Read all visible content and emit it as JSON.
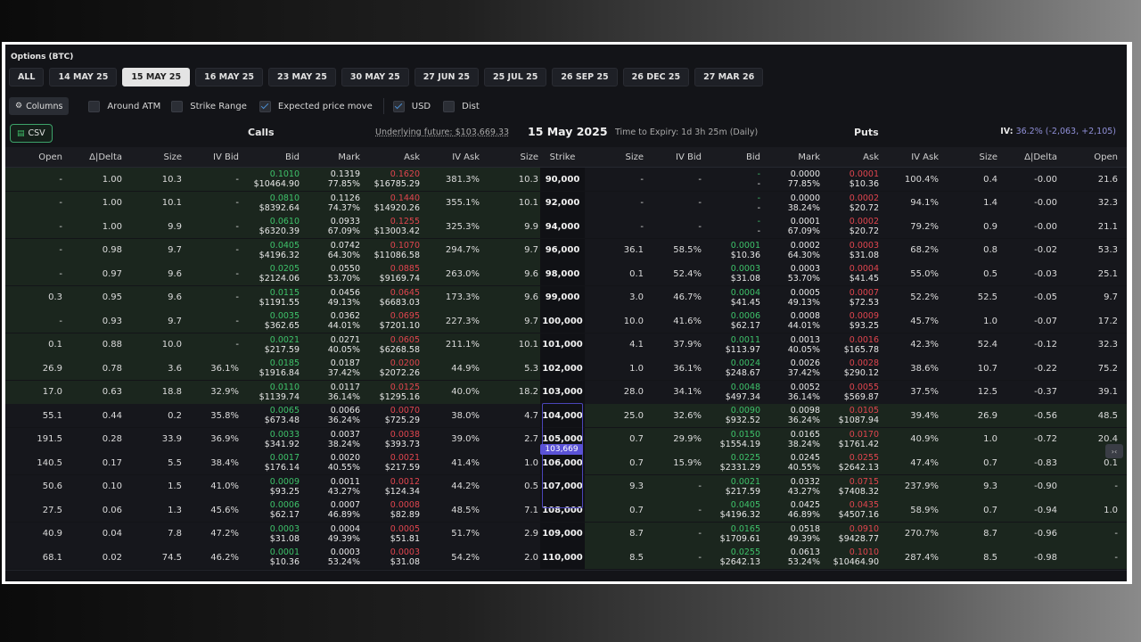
{
  "title": "Options (BTC)",
  "tabs": [
    {
      "label": "ALL",
      "active": false
    },
    {
      "label": "14 MAY 25",
      "active": false
    },
    {
      "label": "15 MAY 25",
      "active": true
    },
    {
      "label": "16 MAY 25",
      "active": false
    },
    {
      "label": "23 MAY 25",
      "active": false
    },
    {
      "label": "30 MAY 25",
      "active": false
    },
    {
      "label": "27 JUN 25",
      "active": false
    },
    {
      "label": "25 JUL 25",
      "active": false
    },
    {
      "label": "26 SEP 25",
      "active": false
    },
    {
      "label": "26 DEC 25",
      "active": false
    },
    {
      "label": "27 MAR 26",
      "active": false
    }
  ],
  "toolbar": {
    "columns_label": "Columns",
    "around_atm": "Around ATM",
    "strike_range": "Strike Range",
    "expected_move": "Expected price move",
    "usd": "USD",
    "dist": "Dist"
  },
  "summary": {
    "csv_label": "CSV",
    "calls": "Calls",
    "underlying": "Underlying future: $103,669.33",
    "date": "15 May 2025",
    "expiry": "Time to Expiry: 1d 3h 25m (Daily)",
    "puts": "Puts",
    "iv_label": "IV:",
    "iv_value": "36.2% (-2,063, +2,105)"
  },
  "columns": [
    "Open",
    "Δ|Delta",
    "Size",
    "IV Bid",
    "Bid",
    "Mark",
    "Ask",
    "IV Ask",
    "Size",
    "Strike",
    "Size",
    "IV Bid",
    "Bid",
    "Mark",
    "Ask",
    "IV Ask",
    "Size",
    "Δ|Delta",
    "Open"
  ],
  "underlying_marker": "103,669",
  "colors": {
    "bid": "#3ec26a",
    "ask": "#e0454e",
    "accent": "#5a52d6"
  },
  "rows": [
    {
      "strike": "90,000",
      "c": [
        "-",
        "1.00",
        "10.3",
        "-",
        "0.1010",
        "$10464.90",
        "0.1319",
        "77.85%",
        "0.1620",
        "$16785.29",
        "381.3%",
        "10.3"
      ],
      "p": [
        "-",
        "-",
        "-",
        "-",
        "0.0000",
        "77.85%",
        "0.0001",
        "$10.36",
        "100.4%",
        "0.4",
        "-0.00",
        "21.6"
      ]
    },
    {
      "strike": "92,000",
      "c": [
        "-",
        "1.00",
        "10.1",
        "-",
        "0.0810",
        "$8392.64",
        "0.1126",
        "74.37%",
        "0.1440",
        "$14920.26",
        "355.1%",
        "10.1"
      ],
      "p": [
        "-",
        "-",
        "-",
        "-",
        "0.0000",
        "38.24%",
        "0.0002",
        "$20.72",
        "94.1%",
        "1.4",
        "-0.00",
        "32.3"
      ]
    },
    {
      "strike": "94,000",
      "c": [
        "-",
        "1.00",
        "9.9",
        "-",
        "0.0610",
        "$6320.39",
        "0.0933",
        "67.09%",
        "0.1255",
        "$13003.42",
        "325.3%",
        "9.9"
      ],
      "p": [
        "-",
        "-",
        "-",
        "-",
        "0.0001",
        "67.09%",
        "0.0002",
        "$20.72",
        "79.2%",
        "0.9",
        "-0.00",
        "21.1"
      ]
    },
    {
      "strike": "96,000",
      "c": [
        "-",
        "0.98",
        "9.7",
        "-",
        "0.0405",
        "$4196.32",
        "0.0742",
        "64.30%",
        "0.1070",
        "$11086.58",
        "294.7%",
        "9.7"
      ],
      "p": [
        "36.1",
        "58.5%",
        "0.0001",
        "$10.36",
        "0.0002",
        "64.30%",
        "0.0003",
        "$31.08",
        "68.2%",
        "0.8",
        "-0.02",
        "53.3"
      ]
    },
    {
      "strike": "98,000",
      "c": [
        "-",
        "0.97",
        "9.6",
        "-",
        "0.0205",
        "$2124.06",
        "0.0550",
        "53.70%",
        "0.0885",
        "$9169.74",
        "263.0%",
        "9.6"
      ],
      "p": [
        "0.1",
        "52.4%",
        "0.0003",
        "$31.08",
        "0.0003",
        "53.70%",
        "0.0004",
        "$41.45",
        "55.0%",
        "0.5",
        "-0.03",
        "25.1"
      ]
    },
    {
      "strike": "99,000",
      "c": [
        "0.3",
        "0.95",
        "9.6",
        "-",
        "0.0115",
        "$1191.55",
        "0.0456",
        "49.13%",
        "0.0645",
        "$6683.03",
        "173.3%",
        "9.6"
      ],
      "p": [
        "3.0",
        "46.7%",
        "0.0004",
        "$41.45",
        "0.0005",
        "49.13%",
        "0.0007",
        "$72.53",
        "52.2%",
        "52.5",
        "-0.05",
        "9.7"
      ]
    },
    {
      "strike": "100,000",
      "c": [
        "-",
        "0.93",
        "9.7",
        "-",
        "0.0035",
        "$362.65",
        "0.0362",
        "44.01%",
        "0.0695",
        "$7201.10",
        "227.3%",
        "9.7"
      ],
      "p": [
        "10.0",
        "41.6%",
        "0.0006",
        "$62.17",
        "0.0008",
        "44.01%",
        "0.0009",
        "$93.25",
        "45.7%",
        "1.0",
        "-0.07",
        "17.2"
      ]
    },
    {
      "strike": "101,000",
      "c": [
        "0.1",
        "0.88",
        "10.0",
        "-",
        "0.0021",
        "$217.59",
        "0.0271",
        "40.05%",
        "0.0605",
        "$6268.58",
        "211.1%",
        "10.1"
      ],
      "p": [
        "4.1",
        "37.9%",
        "0.0011",
        "$113.97",
        "0.0013",
        "40.05%",
        "0.0016",
        "$165.78",
        "42.3%",
        "52.4",
        "-0.12",
        "32.3"
      ]
    },
    {
      "strike": "102,000",
      "c": [
        "26.9",
        "0.78",
        "3.6",
        "36.1%",
        "0.0185",
        "$1916.84",
        "0.0187",
        "37.42%",
        "0.0200",
        "$2072.26",
        "44.9%",
        "5.3"
      ],
      "p": [
        "1.0",
        "36.1%",
        "0.0024",
        "$248.67",
        "0.0026",
        "37.42%",
        "0.0028",
        "$290.12",
        "38.6%",
        "10.7",
        "-0.22",
        "75.2"
      ]
    },
    {
      "strike": "103,000",
      "c": [
        "17.0",
        "0.63",
        "18.8",
        "32.9%",
        "0.0110",
        "$1139.74",
        "0.0117",
        "36.14%",
        "0.0125",
        "$1295.16",
        "40.0%",
        "18.2"
      ],
      "p": [
        "28.0",
        "34.1%",
        "0.0048",
        "$497.34",
        "0.0052",
        "36.14%",
        "0.0055",
        "$569.87",
        "37.5%",
        "12.5",
        "-0.37",
        "39.1"
      ]
    },
    {
      "strike": "104,000",
      "c": [
        "55.1",
        "0.44",
        "0.2",
        "35.8%",
        "0.0065",
        "$673.48",
        "0.0066",
        "36.24%",
        "0.0070",
        "$725.29",
        "38.0%",
        "4.7"
      ],
      "p": [
        "25.0",
        "32.6%",
        "0.0090",
        "$932.52",
        "0.0098",
        "36.24%",
        "0.0105",
        "$1087.94",
        "39.4%",
        "26.9",
        "-0.56",
        "48.5"
      ]
    },
    {
      "strike": "105,000",
      "c": [
        "191.5",
        "0.28",
        "33.9",
        "36.9%",
        "0.0033",
        "$341.92",
        "0.0037",
        "38.24%",
        "0.0038",
        "$393.73",
        "39.0%",
        "2.7"
      ],
      "p": [
        "0.7",
        "29.9%",
        "0.0150",
        "$1554.19",
        "0.0165",
        "38.24%",
        "0.0170",
        "$1761.42",
        "40.9%",
        "1.0",
        "-0.72",
        "20.4"
      ]
    },
    {
      "strike": "106,000",
      "c": [
        "140.5",
        "0.17",
        "5.5",
        "38.4%",
        "0.0017",
        "$176.14",
        "0.0020",
        "40.55%",
        "0.0021",
        "$217.59",
        "41.4%",
        "1.0"
      ],
      "p": [
        "0.7",
        "15.9%",
        "0.0225",
        "$2331.29",
        "0.0245",
        "40.55%",
        "0.0255",
        "$2642.13",
        "47.4%",
        "0.7",
        "-0.83",
        "0.1"
      ]
    },
    {
      "strike": "107,000",
      "c": [
        "50.6",
        "0.10",
        "1.5",
        "41.0%",
        "0.0009",
        "$93.25",
        "0.0011",
        "43.27%",
        "0.0012",
        "$124.34",
        "44.2%",
        "0.5"
      ],
      "p": [
        "9.3",
        "-",
        "0.0021",
        "$217.59",
        "0.0332",
        "43.27%",
        "0.0715",
        "$7408.32",
        "237.9%",
        "9.3",
        "-0.90",
        "-"
      ]
    },
    {
      "strike": "108,000",
      "c": [
        "27.5",
        "0.06",
        "1.3",
        "45.6%",
        "0.0006",
        "$62.17",
        "0.0007",
        "46.89%",
        "0.0008",
        "$82.89",
        "48.5%",
        "7.1"
      ],
      "p": [
        "0.7",
        "-",
        "0.0405",
        "$4196.32",
        "0.0425",
        "46.89%",
        "0.0435",
        "$4507.16",
        "58.9%",
        "0.7",
        "-0.94",
        "1.0"
      ]
    },
    {
      "strike": "109,000",
      "c": [
        "40.9",
        "0.04",
        "7.8",
        "47.2%",
        "0.0003",
        "$31.08",
        "0.0004",
        "49.39%",
        "0.0005",
        "$51.81",
        "51.7%",
        "2.9"
      ],
      "p": [
        "8.7",
        "-",
        "0.0165",
        "$1709.61",
        "0.0518",
        "49.39%",
        "0.0910",
        "$9428.77",
        "270.7%",
        "8.7",
        "-0.96",
        "-"
      ]
    },
    {
      "strike": "110,000",
      "c": [
        "68.1",
        "0.02",
        "74.5",
        "46.2%",
        "0.0001",
        "$10.36",
        "0.0003",
        "53.24%",
        "0.0003",
        "$31.08",
        "54.2%",
        "2.0"
      ],
      "p": [
        "8.5",
        "-",
        "0.0255",
        "$2642.13",
        "0.0613",
        "53.24%",
        "0.1010",
        "$10464.90",
        "287.4%",
        "8.5",
        "-0.98",
        "-"
      ]
    }
  ]
}
